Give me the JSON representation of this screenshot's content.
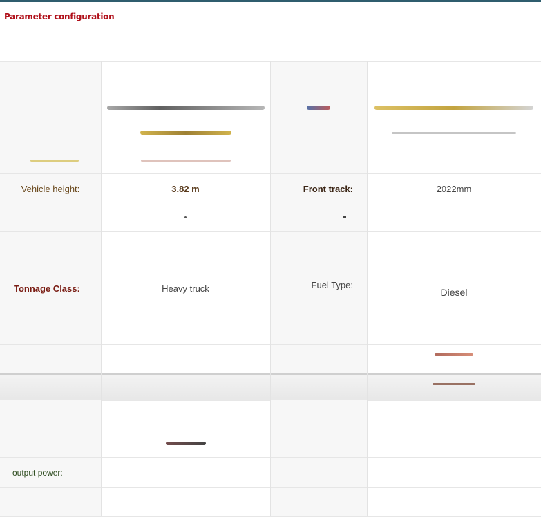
{
  "page": {
    "title": "Parameter configuration"
  },
  "rows": {
    "vehicle_height": {
      "label": "Vehicle height:",
      "value": "3.82 m"
    },
    "front_track": {
      "label": "Front track:",
      "value": "2022mm"
    },
    "tonnage_class": {
      "label": "Tonnage Class:",
      "value": "Heavy truck"
    },
    "fuel_type": {
      "label": "Fuel Type:",
      "value": "Diesel"
    },
    "output_power": {
      "label": "output power:"
    }
  },
  "colors": {
    "title": "#b0101a",
    "top_bar": "#2f5d6e",
    "label_bg": "#f7f7f7",
    "grid_line": "#e6e6e6"
  }
}
